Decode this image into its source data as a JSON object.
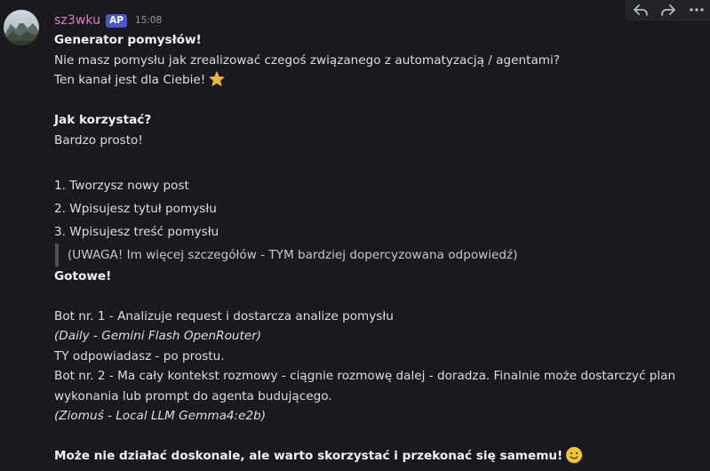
{
  "message": {
    "username": "sz3wku",
    "tag": "AP",
    "timestamp": "15:08",
    "avatar_icon": "mountain-landscape-avatar",
    "toolbar": {
      "icons": [
        "reply-icon",
        "forward-icon",
        "more-icon"
      ]
    },
    "lines": {
      "title": "Generator pomysłów!",
      "line1": "Nie masz pomysłu jak zrealizować czegoś związanego z automatyzacją / agentami?",
      "line2": "Ten kanał jest dla Ciebie!",
      "how_title": "Jak korzystać?",
      "how_text": "Bardzo prosto!",
      "steps": [
        "1. Tworzysz nowy post",
        "2. Wpisujesz tytuł pomysłu",
        "3. Wpisujesz treść pomysłu"
      ],
      "quote": "(UWAGA! Im więcej szczegółów - TYM bardziej dopercyzowana odpowiedź)",
      "ready": "Gotowe!",
      "bot1": "Bot nr. 1 - Analizuje request i dostarcza analize pomysłu",
      "bot1_model": "(Daily - Gemini Flash OpenRouter)",
      "you_answer": "TY odpowiadasz - po prostu.",
      "bot2": "Bot nr. 2 - Ma cały kontekst rozmowy - ciągnie rozmowę dalej - doradza. Finalnie może dostarczyć plan",
      "bot2_cont": "wykonania lub prompt do agenta budującego.",
      "bot2_model": "(Ziomuś - Local LLM Gemma4:e2b)",
      "final": "Może nie działać doskonale, ale warto skorzystać i przekonać się samemu!"
    },
    "emojis": {
      "star": "star-emoji",
      "smile": "slightly-smiling-face-emoji"
    }
  },
  "colors": {
    "background": "#1a1a1e",
    "username": "#e879c4",
    "tag_bg": "#4a56c9",
    "text": "#dbdee1",
    "muted": "#949ba4"
  }
}
